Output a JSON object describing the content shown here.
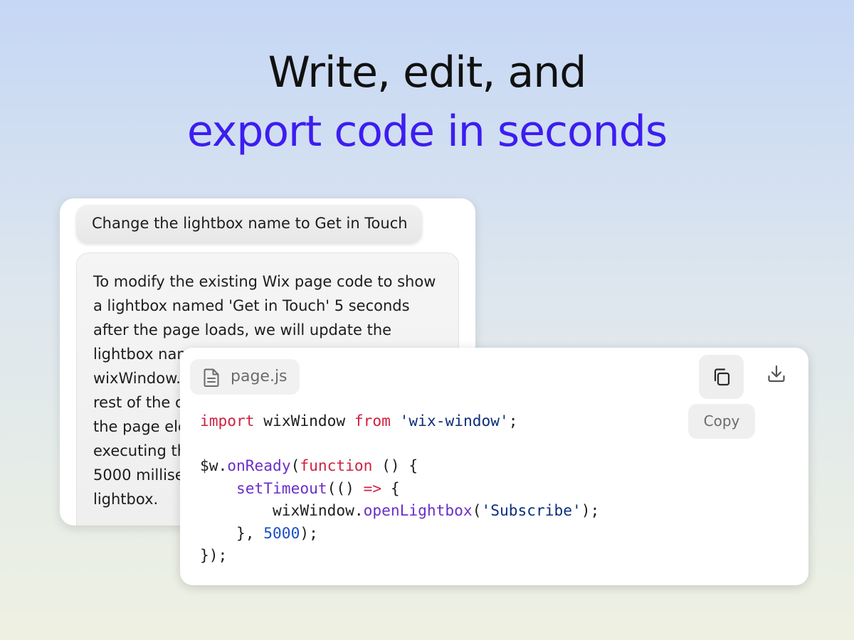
{
  "headline": {
    "line1": "Write, edit, and",
    "line2": "export code in seconds"
  },
  "colors": {
    "accent": "#3d1df0",
    "keyword": "#cf2241",
    "string": "#0b2f7a",
    "function": "#6a2fc9",
    "number": "#1a4fc2"
  },
  "chat": {
    "user_message": "Change the lightbox name to Get in Touch",
    "assistant_lines": [
      "To modify the existing Wix page code to show",
      "a lightbox named 'Get in Touch' 5 seconds",
      "after the page loads, we will update the",
      "lightbox nam",
      "wixWindow.",
      "rest of the c",
      "the page ele",
      "executing th",
      "5000 millise",
      "lightbox."
    ]
  },
  "code_panel": {
    "file_name": "page.js",
    "file_icon": "document-icon",
    "copy_icon": "copy-icon",
    "download_icon": "download-icon",
    "copy_tooltip": "Copy",
    "lines": [
      [
        {
          "text": "import",
          "type": "kw"
        },
        {
          "text": " wixWindow ",
          "type": "plain"
        },
        {
          "text": "from",
          "type": "kw"
        },
        {
          "text": " ",
          "type": "plain"
        },
        {
          "text": "'wix-window'",
          "type": "str"
        },
        {
          "text": ";",
          "type": "plain"
        }
      ],
      [],
      [
        {
          "text": "$w.",
          "type": "plain"
        },
        {
          "text": "onReady",
          "type": "fn"
        },
        {
          "text": "(",
          "type": "plain"
        },
        {
          "text": "function",
          "type": "kw"
        },
        {
          "text": " () {",
          "type": "plain"
        }
      ],
      [
        {
          "text": "    ",
          "type": "plain"
        },
        {
          "text": "setTimeout",
          "type": "fn"
        },
        {
          "text": "(() ",
          "type": "plain"
        },
        {
          "text": "=>",
          "type": "kw"
        },
        {
          "text": " {",
          "type": "plain"
        }
      ],
      [
        {
          "text": "        wixWindow.",
          "type": "plain"
        },
        {
          "text": "openLightbox",
          "type": "fn"
        },
        {
          "text": "(",
          "type": "plain"
        },
        {
          "text": "'Subscribe'",
          "type": "str"
        },
        {
          "text": ");",
          "type": "plain"
        }
      ],
      [
        {
          "text": "    }, ",
          "type": "plain"
        },
        {
          "text": "5000",
          "type": "num"
        },
        {
          "text": ");",
          "type": "plain"
        }
      ],
      [
        {
          "text": "});",
          "type": "plain"
        }
      ]
    ]
  }
}
